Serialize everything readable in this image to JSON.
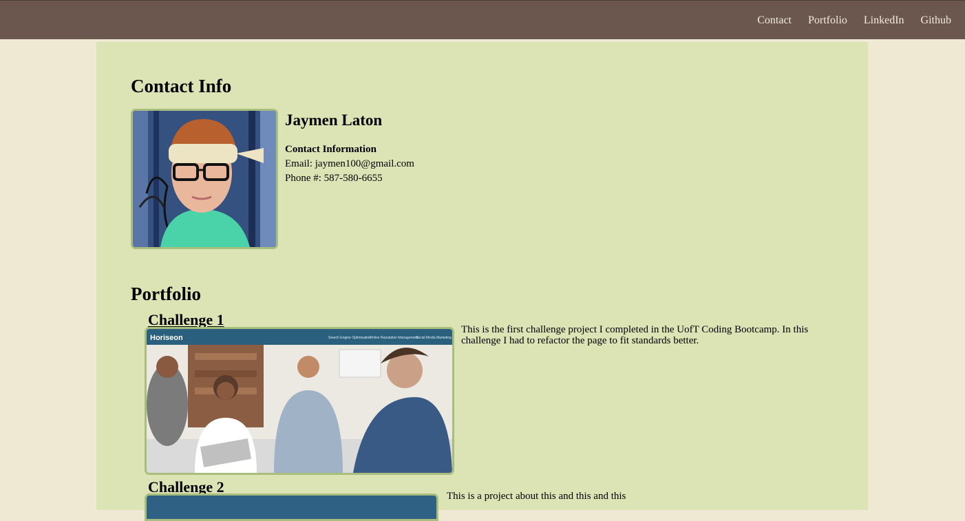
{
  "nav": {
    "items": [
      "Contact",
      "Portfolio",
      "LinkedIn",
      "Github"
    ]
  },
  "contact": {
    "section_title": "Contact Info",
    "name": "Jaymen Laton",
    "info_heading": "Contact Information",
    "email": "Email: jaymen100@gmail.com",
    "phone": "Phone #: 587-580-6655"
  },
  "portfolio": {
    "section_title": "Portfolio",
    "challenges": [
      {
        "title": "Challenge 1",
        "description": "This is the first challenge project I completed in the UofT Coding Bootcamp. In this challenge I had to refactor the page to fit standards better.",
        "screenshot": {
          "brand": "Horiseon",
          "nav": [
            "Search Engine Optimization",
            "Online Reputation Management",
            "Social Media Marketing"
          ]
        }
      },
      {
        "title": "Challenge 2",
        "description": "This is a project about this and this and this"
      }
    ]
  },
  "colors": {
    "topbar": "#6b574d",
    "page_bg": "#efe8d3",
    "main_bg": "#dce4b6",
    "image_border": "#a9bd7d"
  }
}
